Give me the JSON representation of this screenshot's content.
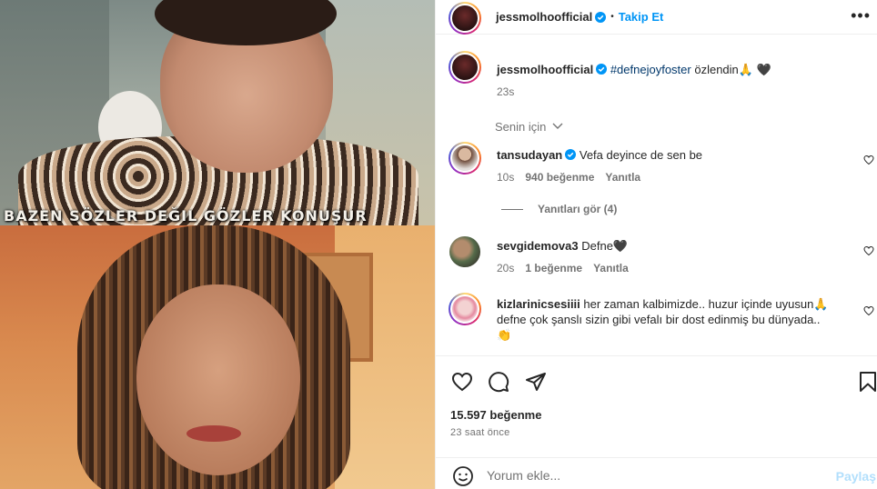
{
  "media": {
    "caption_overlay": "BAZEN SÖZLER DEĞIL GÖZLER KONUŞUR"
  },
  "header": {
    "username": "jessmolhoofficial",
    "separator": "•",
    "follow_label": "Takip Et",
    "more_icon": "more-horizontal-icon"
  },
  "post_caption": {
    "username": "jessmolhoofficial",
    "hashtag": "#defnejoyfoster",
    "text": " özlendin🙏 🖤",
    "time": "23s"
  },
  "filter": {
    "label": "Senin için",
    "icon": "chevron-down-icon"
  },
  "comments": [
    {
      "username": "tansudayan",
      "verified": true,
      "text": "Vefa deyince de sen be",
      "time": "10s",
      "likes": "940 beğenme",
      "reply": "Yanıtla",
      "view_replies": "Yanıtları gör (4)"
    },
    {
      "username": "sevgidemova3",
      "verified": false,
      "text": "Defne🖤",
      "time": "20s",
      "likes": "1 beğenme",
      "reply": "Yanıtla"
    },
    {
      "username": "kizlarinicsesiiii",
      "verified": false,
      "text": "her zaman kalbimizde.. huzur içinde uyusun🙏",
      "text2": "defne çok şanslı sizin gibi vefalı bir dost edinmiş bu dünyada..",
      "text3": "👏"
    }
  ],
  "actions": {
    "likes": "15.597 beğenme",
    "time_ago": "23 saat önce"
  },
  "composer": {
    "placeholder": "Yorum ekle...",
    "post_label": "Paylaş"
  },
  "colors": {
    "accent": "#0095f6",
    "text": "#262626",
    "muted": "#737373",
    "post_disabled": "#b2dffc"
  }
}
